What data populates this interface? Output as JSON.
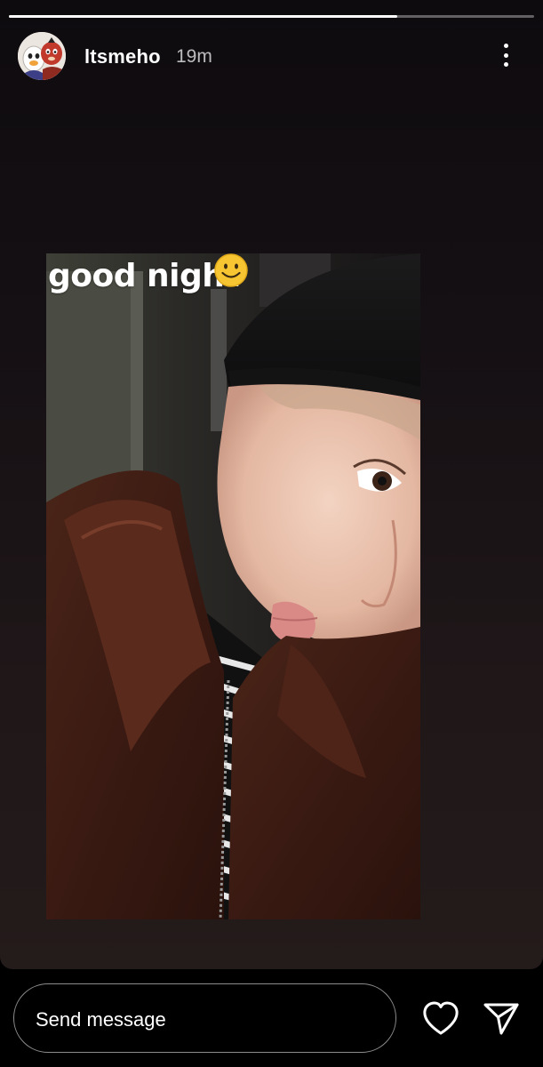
{
  "story": {
    "progress": 0.74,
    "user": {
      "username": "ltsmeho",
      "time_ago": "19m",
      "avatar_icon": "cartoon-avatar-icon"
    },
    "more_icon": "more-vertical-icon",
    "media": {
      "sticker_text": "good night",
      "sticker_emoji_icon": "smiling-face-emoji-icon"
    }
  },
  "footer": {
    "message_placeholder": "Send message",
    "like_icon": "heart-icon",
    "share_icon": "paper-plane-icon"
  },
  "colors": {
    "background": "#000000",
    "text": "#ffffff",
    "emoji_fill": "#f7c531"
  }
}
